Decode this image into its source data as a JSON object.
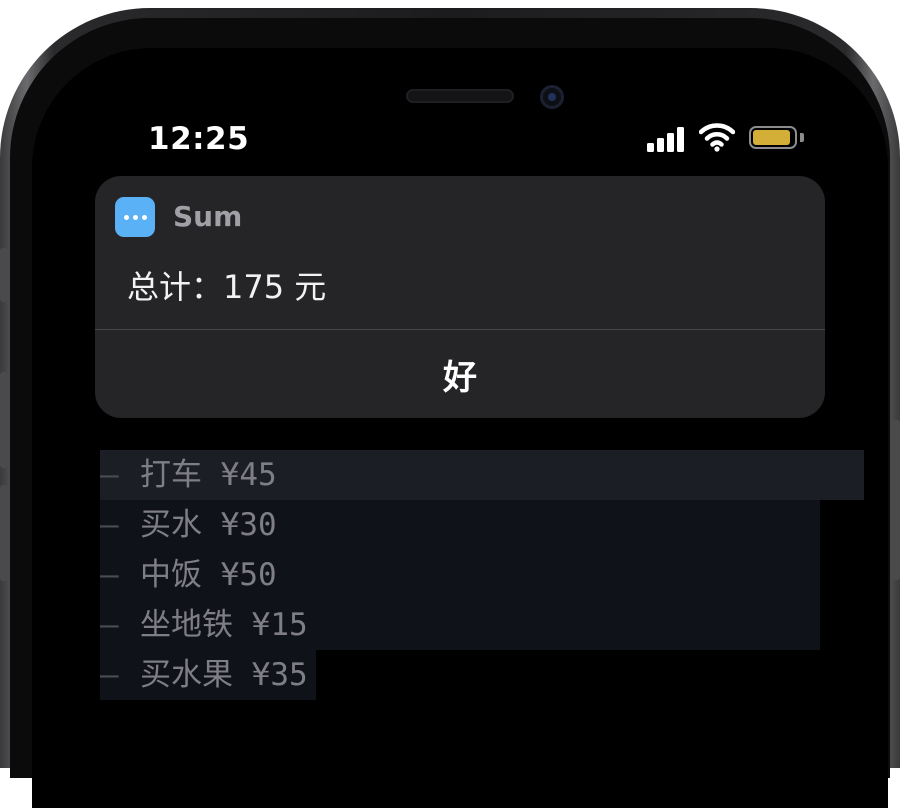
{
  "status_bar": {
    "time": "12:25",
    "signal_icon": "cellular-signal-icon",
    "wifi_icon": "wifi-icon",
    "battery_icon": "battery-icon",
    "battery_level": 0.95,
    "battery_color": "#d4af37"
  },
  "alert": {
    "app_icon": "more-dots-icon",
    "app_icon_color": "#5bb1f5",
    "app_name": "Sum",
    "message": "总计：175 元",
    "ok_label": "好"
  },
  "list": {
    "items": [
      {
        "text": "打车 ¥45"
      },
      {
        "text": "买水 ¥30"
      },
      {
        "text": "中饭 ¥50"
      },
      {
        "text": "坐地铁 ¥15"
      },
      {
        "text": "买水果 ¥35"
      }
    ]
  }
}
